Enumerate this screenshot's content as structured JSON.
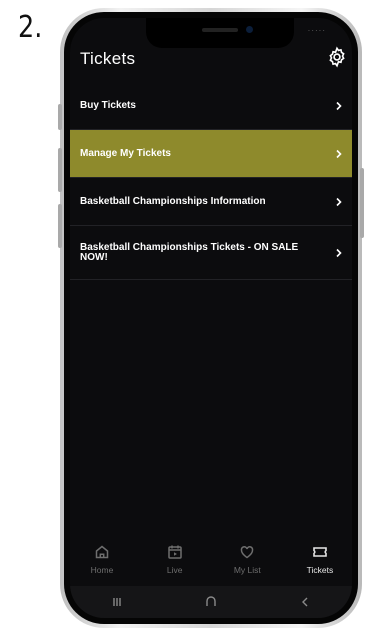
{
  "step_label": "2.",
  "header": {
    "title": "Tickets",
    "settings_icon": "gear-icon"
  },
  "menu": {
    "items": [
      {
        "label": "Buy Tickets",
        "highlighted": false
      },
      {
        "label": "Manage My Tickets",
        "highlighted": true
      },
      {
        "label": "Basketball Championships Information",
        "highlighted": false
      },
      {
        "label": "Basketball Championships Tickets - ON SALE NOW!",
        "highlighted": false
      }
    ]
  },
  "tabbar": {
    "tabs": [
      {
        "label": "Home",
        "icon": "home-icon",
        "active": false
      },
      {
        "label": "Live",
        "icon": "tv-icon",
        "active": false
      },
      {
        "label": "My List",
        "icon": "heart-icon",
        "active": false
      },
      {
        "label": "Tickets",
        "icon": "ticket-icon",
        "active": true
      }
    ]
  },
  "colors": {
    "highlight": "#8e8a2c",
    "screen_bg": "#0c0c0e",
    "text": "#ffffff",
    "inactive_tab": "#6e6e6e"
  }
}
